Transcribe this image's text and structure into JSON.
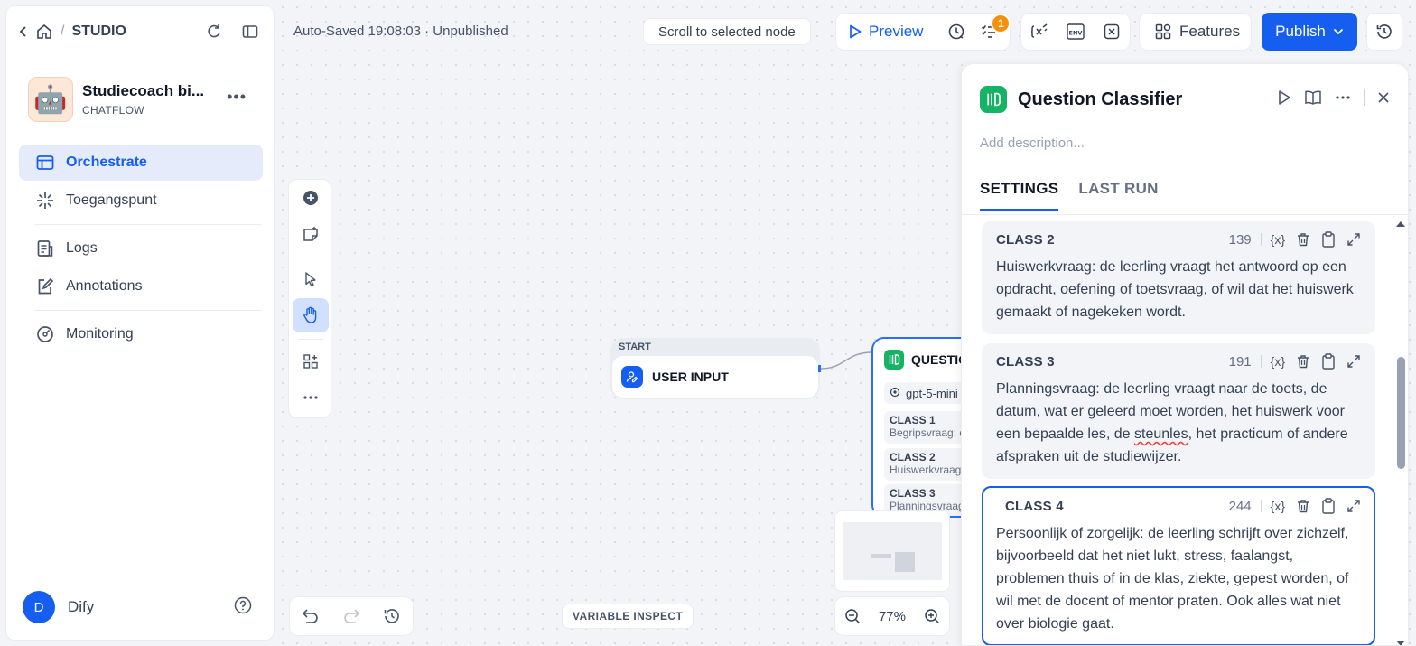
{
  "sidebar": {
    "breadcrumb": "STUDIO",
    "app": {
      "name": "Studiecoach bi...",
      "type": "CHATFLOW",
      "avatar": "🤖"
    },
    "nav": [
      {
        "label": "Orchestrate",
        "icon": "orchestrate-icon",
        "active": true
      },
      {
        "label": "Toegangspunt",
        "icon": "access-point-icon"
      },
      {
        "label": "Logs",
        "icon": "logs-icon"
      },
      {
        "label": "Annotations",
        "icon": "annotations-icon"
      },
      {
        "label": "Monitoring",
        "icon": "monitoring-icon"
      }
    ],
    "user": {
      "initial": "D",
      "name": "Dify"
    }
  },
  "header": {
    "autosave": "Auto-Saved 19:08:03 · Unpublished",
    "scroll_to_node": "Scroll to selected node",
    "preview": "Preview",
    "badge_count": "1",
    "features": "Features",
    "publish": "Publish"
  },
  "canvas": {
    "start_label": "START",
    "start_node": "USER INPUT",
    "q_node_title": "QUESTIO",
    "q_node_model": "gpt-5-mini",
    "q_node_classes": [
      {
        "title": "CLASS 1",
        "desc": "Begripsvraag: d"
      },
      {
        "title": "CLASS 2",
        "desc": "Huiswerkvraag"
      },
      {
        "title": "CLASS 3",
        "desc": "Planningsvraag"
      }
    ],
    "zoom": "77%",
    "variable_inspect": "VARIABLE INSPECT"
  },
  "panel": {
    "title": "Question Classifier",
    "description_placeholder": "Add description...",
    "tabs": [
      "SETTINGS",
      "LAST RUN"
    ],
    "classes": [
      {
        "title": "CLASS 2",
        "count": "139",
        "text": "Huiswerkvraag: de leerling vraagt het antwoord op een opdracht, oefening of toetsvraag, of wil dat het huiswerk gemaakt of nagekeken wordt."
      },
      {
        "title": "CLASS 3",
        "count": "191",
        "text_before": "Planningsvraag: de leerling vraagt naar de toets, de datum, wat er geleerd moet worden, het huiswerk voor een bepaalde les, de ",
        "text_flagged": "steunles",
        "text_after": ", het practicum of andere afspraken uit de studiewijzer."
      },
      {
        "title": "CLASS 4",
        "count": "244",
        "text": "Persoonlijk of zorgelijk: de leerling schrijft over zichzelf, bijvoorbeeld dat het niet lukt, stress, faalangst, problemen thuis of in de klas, ziekte, gepest worden, of wil met de docent of mentor praten. Ook alles wat niet over biologie gaat."
      }
    ]
  },
  "colors": {
    "accent": "#155eef",
    "node_green": "#16b364",
    "badge": "#f79009"
  }
}
